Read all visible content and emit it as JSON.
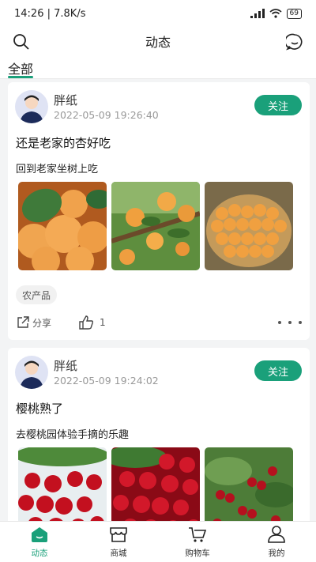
{
  "status": {
    "time": "14:26",
    "speed": "7.8K/s",
    "battery": "69"
  },
  "header": {
    "title": "动态"
  },
  "tabs": [
    {
      "label": "全部"
    }
  ],
  "posts": [
    {
      "author": "胖纸",
      "time": "2022-05-09 19:26:40",
      "follow_label": "关注",
      "title": "还是老家的杏好吃",
      "body": "回到老家坐树上吃",
      "tag": "农产品",
      "share_label": "分享",
      "likes": "1"
    },
    {
      "author": "胖纸",
      "time": "2022-05-09 19:24:02",
      "follow_label": "关注",
      "title": "樱桃熟了",
      "body": "去樱桃园体验手摘的乐趣"
    }
  ],
  "bottom_nav": [
    {
      "label": "动态",
      "icon": "home-icon",
      "active": true
    },
    {
      "label": "商城",
      "icon": "store-icon",
      "active": false
    },
    {
      "label": "购物车",
      "icon": "cart-icon",
      "active": false
    },
    {
      "label": "我的",
      "icon": "user-icon",
      "active": false
    }
  ],
  "colors": {
    "accent": "#1aa07a"
  }
}
